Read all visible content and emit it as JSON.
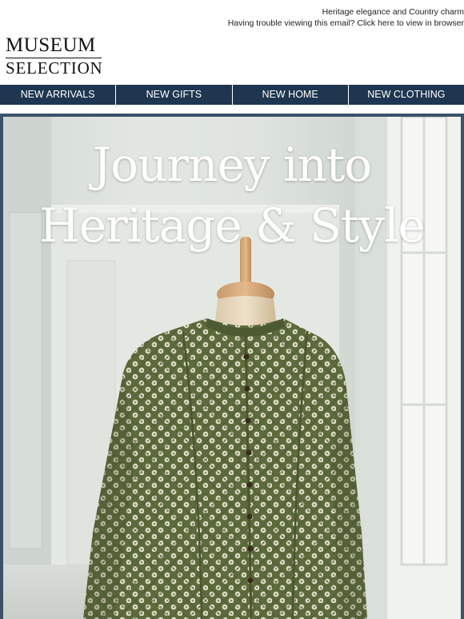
{
  "preheader": {
    "tagline": "Heritage elegance and Country charm",
    "view_in_browser": "Having trouble viewing this email? Click here to view in browser"
  },
  "brand": {
    "line1": "MUSEUM",
    "line2": "SELECTION"
  },
  "nav": {
    "items": [
      {
        "label": "NEW ARRIVALS"
      },
      {
        "label": "NEW GIFTS"
      },
      {
        "label": "NEW HOME"
      },
      {
        "label": "NEW CLOTHING"
      }
    ]
  },
  "hero": {
    "headline_line1": "Journey into",
    "headline_line2": "Heritage & Style"
  },
  "colors": {
    "nav_bg": "#1e3650",
    "frame": "#3b5168",
    "jacket": "#5e6b3e"
  }
}
